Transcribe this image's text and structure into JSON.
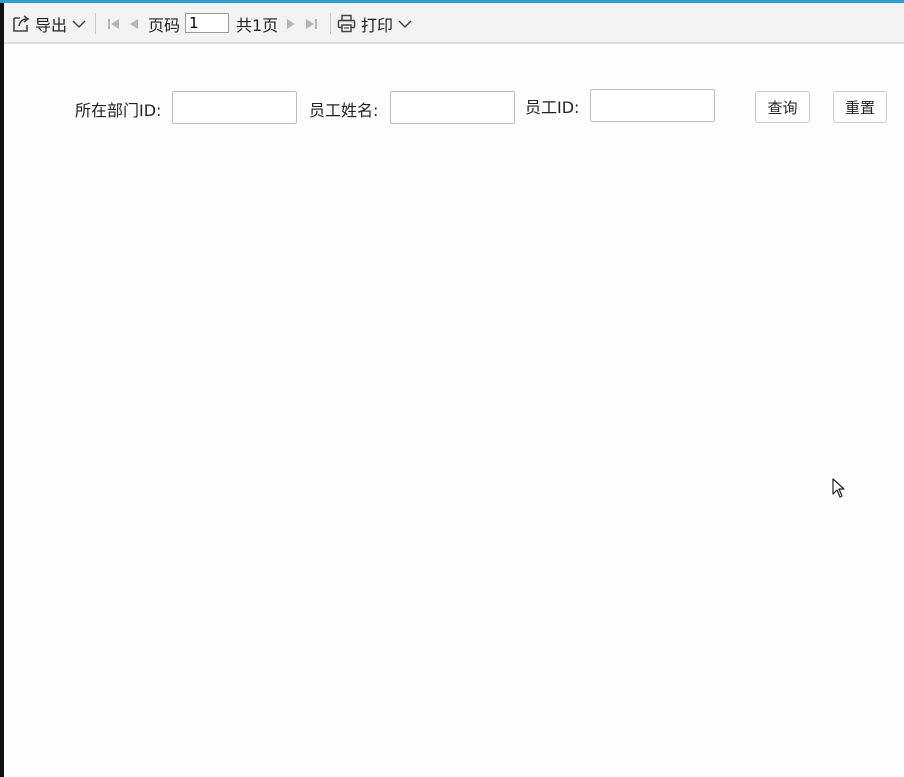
{
  "toolbar": {
    "export_label": "导出",
    "page_label": "页码",
    "page_value": "1",
    "total_pages": "共1页",
    "print_label": "打印",
    "icons": {
      "export": "export-icon",
      "export_dropdown": "chevron-down-icon",
      "first_page": "first-page-icon",
      "prev_page": "prev-page-icon",
      "next_page": "next-page-icon",
      "last_page": "last-page-icon",
      "print": "printer-icon",
      "print_dropdown": "chevron-down-icon"
    }
  },
  "filter": {
    "dept_id_label": "所在部门ID:",
    "dept_id_value": "",
    "employee_name_label": "员工姓名:",
    "employee_name_value": "",
    "employee_id_label": "员工ID:",
    "employee_id_value": "",
    "query_button": "查询",
    "reset_button": "重置"
  },
  "colors": {
    "accent": "#2a9de0",
    "toolbar_bg": "#f3f3f3",
    "disabled_icon": "#b5b5b5"
  }
}
